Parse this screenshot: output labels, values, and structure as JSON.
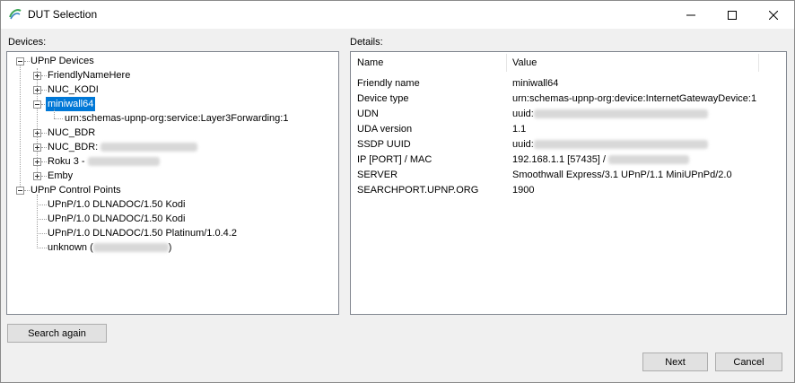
{
  "window": {
    "title": "DUT Selection",
    "accent": "#0078d7",
    "icons": {
      "app": "app-logo-icon",
      "minimize": "minimize-icon",
      "maximize": "maximize-icon",
      "close": "close-icon"
    }
  },
  "labels": {
    "devices": "Devices:",
    "details": "Details:"
  },
  "tree": {
    "upnp_devices": "UPnP Devices",
    "friendly_name_here": "FriendlyNameHere",
    "nuc_kodi": "NUC_KODI",
    "miniwall64": "miniwall64",
    "layer3": "urn:schemas-upnp-org:service:Layer3Forwarding:1",
    "nuc_bdr": "NUC_BDR",
    "nuc_bdr_colon": "NUC_BDR:",
    "roku": "Roku 3 -",
    "emby": "Emby",
    "control_points": "UPnP Control Points",
    "cp1": "UPnP/1.0 DLNADOC/1.50 Kodi",
    "cp2": "UPnP/1.0 DLNADOC/1.50 Kodi",
    "cp3": "UPnP/1.0 DLNADOC/1.50 Platinum/1.0.4.2",
    "unknown_open": "unknown (",
    "unknown_close": ")"
  },
  "details": {
    "col_name": "Name",
    "col_value": "Value",
    "rows": [
      {
        "name": "Friendly name",
        "value": "miniwall64"
      },
      {
        "name": "Device type",
        "value": "urn:schemas-upnp-org:device:InternetGatewayDevice:1"
      },
      {
        "name": "UDN",
        "value": "uuid:"
      },
      {
        "name": "UDA version",
        "value": "1.1"
      },
      {
        "name": "SSDP UUID",
        "value": "uuid:"
      },
      {
        "name": "IP [PORT] / MAC",
        "value": "192.168.1.1 [57435] /"
      },
      {
        "name": "SERVER",
        "value": "Smoothwall Express/3.1 UPnP/1.1 MiniUPnPd/2.0"
      },
      {
        "name": "SEARCHPORT.UPNP.ORG",
        "value": "1900"
      }
    ]
  },
  "buttons": {
    "search_again": "Search again",
    "next": "Next",
    "cancel": "Cancel"
  }
}
